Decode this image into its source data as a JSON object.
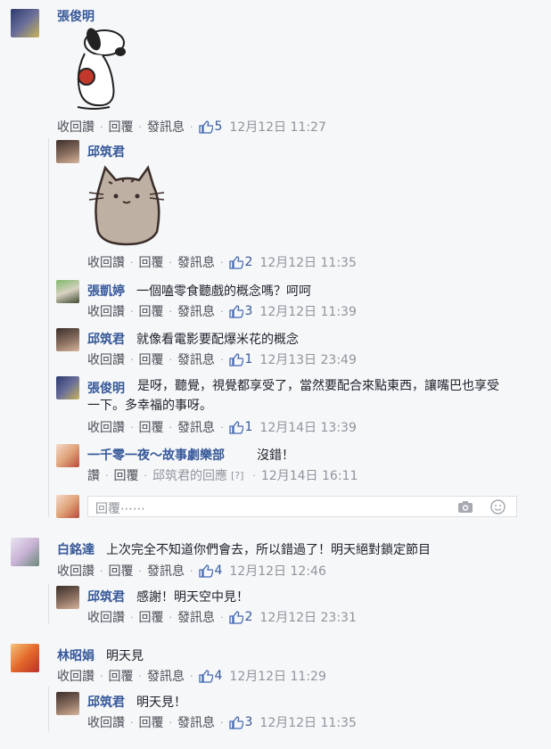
{
  "comments": [
    {
      "name": "張俊明",
      "text": "",
      "actions": {
        "retract": "收回讚",
        "reply": "回覆",
        "message": "發訊息",
        "likes": "5",
        "time": "12月12日 11:27"
      },
      "replies": [
        {
          "name": "邱筑君",
          "text": "",
          "actions": {
            "retract": "收回讚",
            "reply": "回覆",
            "message": "發訊息",
            "likes": "2",
            "time": "12月12日 11:35"
          }
        },
        {
          "name": "張凱婷",
          "text": "一個嗑零食聽戲的概念嗎？呵呵",
          "actions": {
            "retract": "收回讚",
            "reply": "回覆",
            "message": "發訊息",
            "likes": "3",
            "time": "12月12日 11:39"
          }
        },
        {
          "name": "邱筑君",
          "text": "就像看電影要配爆米花的概念",
          "actions": {
            "retract": "收回讚",
            "reply": "回覆",
            "message": "發訊息",
            "likes": "1",
            "time": "12月13日 23:49"
          }
        },
        {
          "name": "張俊明",
          "text": "是呀，聽覺，視覺都享受了，當然要配合來點東西，讓嘴巴也享受一下。多幸福的事呀。",
          "actions": {
            "retract": "收回讚",
            "reply": "回覆",
            "message": "發訊息",
            "likes": "1",
            "time": "12月14日 13:39"
          }
        },
        {
          "name": "一千零一夜～故事劇樂部",
          "text": "沒錯！",
          "actions": {
            "like": "讚",
            "reply": "回覆",
            "reply_to": "邱筑君的回應",
            "time": "12月14日 16:11"
          }
        }
      ],
      "reply_placeholder": "回覆⋯⋯"
    },
    {
      "name": "白銘達",
      "text": "上次完全不知道你們會去，所以錯過了！明天絕對鎖定節目",
      "actions": {
        "retract": "收回讚",
        "reply": "回覆",
        "message": "發訊息",
        "likes": "4",
        "time": "12月12日 12:46"
      },
      "replies": [
        {
          "name": "邱筑君",
          "text": "感謝！明天空中見！",
          "actions": {
            "retract": "收回讚",
            "reply": "回覆",
            "message": "發訊息",
            "likes": "2",
            "time": "12月12日 23:31"
          }
        }
      ]
    },
    {
      "name": "林昭娟",
      "text": "明天見",
      "actions": {
        "retract": "收回讚",
        "reply": "回覆",
        "message": "發訊息",
        "likes": "4",
        "time": "12月12日 11:29"
      },
      "replies": [
        {
          "name": "邱筑君",
          "text": "明天見！",
          "actions": {
            "retract": "收回讚",
            "reply": "回覆",
            "message": "發訊息",
            "likes": "3",
            "time": "12月12日 11:35"
          }
        }
      ]
    }
  ],
  "colors": {
    "link": "#365899",
    "text": "#1d2129",
    "meta": "#90949c",
    "background": "#f6f7f9"
  }
}
